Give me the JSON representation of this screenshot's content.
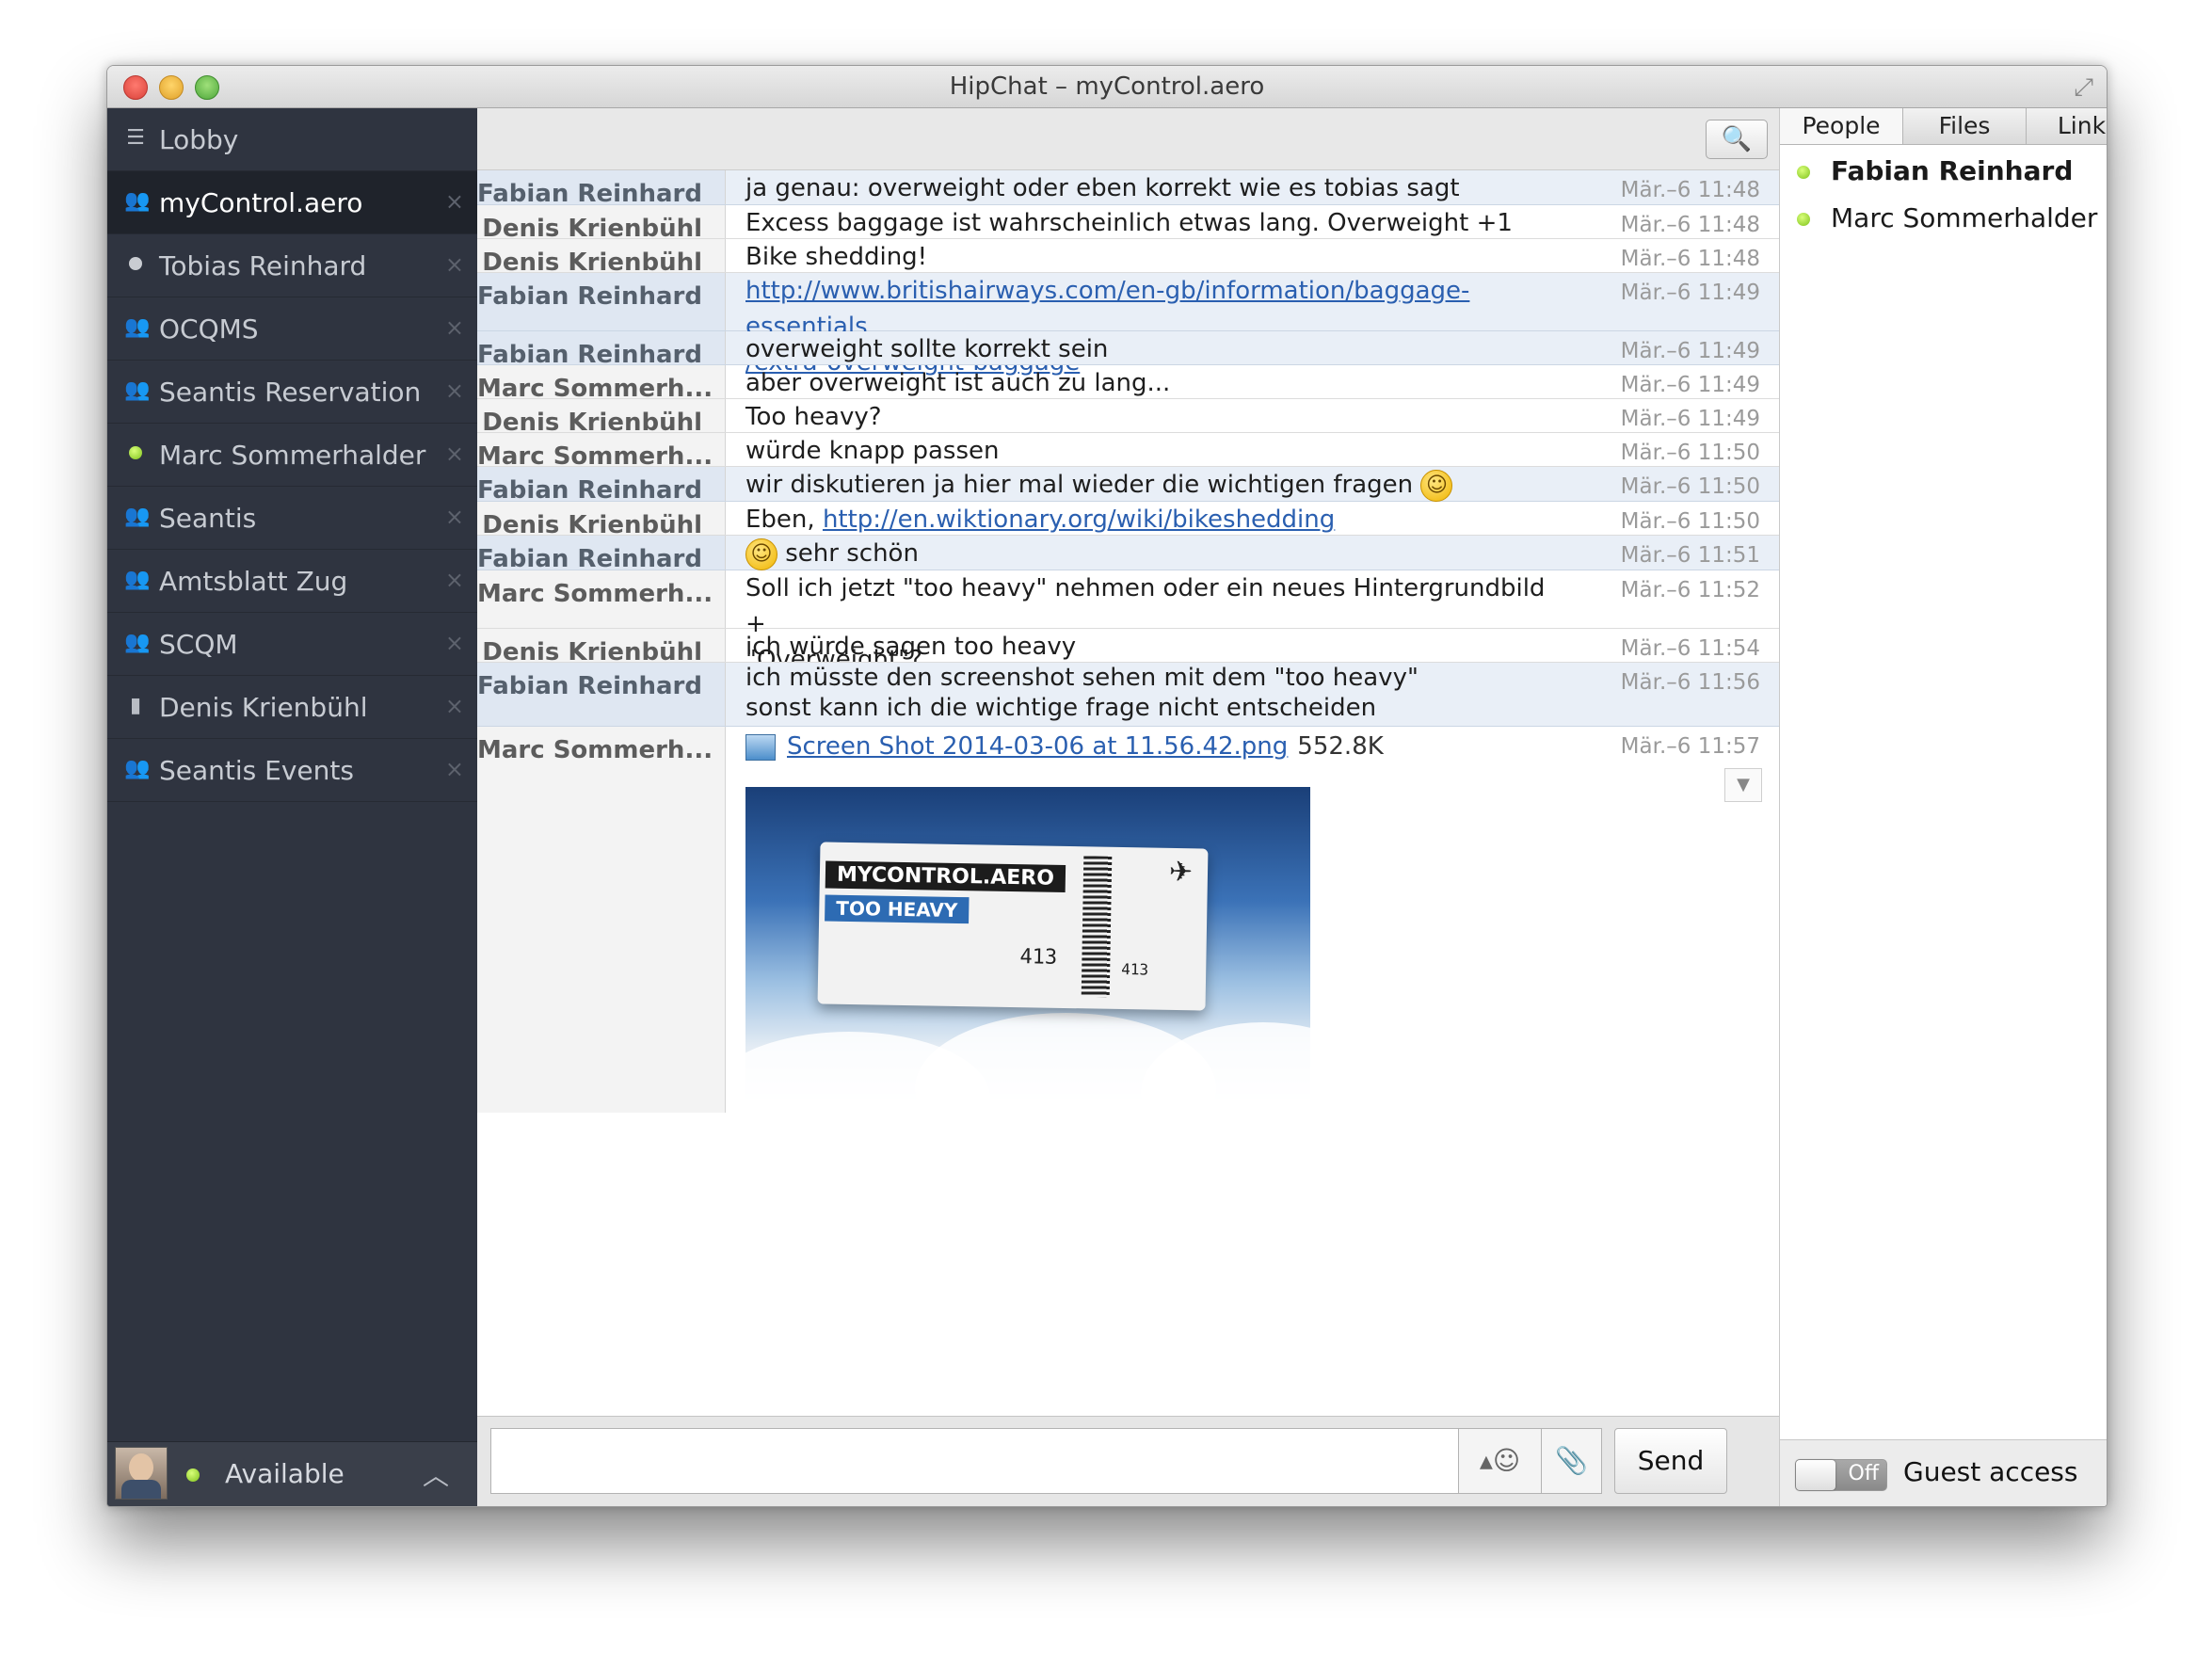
{
  "window": {
    "title": "HipChat – myControl.aero"
  },
  "sidebar": {
    "rooms": [
      {
        "label": "Lobby",
        "icon": "list-icon",
        "closable": false
      },
      {
        "label": "myControl.aero",
        "icon": "group-icon",
        "closable": true,
        "active": true
      },
      {
        "label": "Tobias Reinhard",
        "icon": "grey-status-dot",
        "closable": true
      },
      {
        "label": "OCQMS",
        "icon": "group-icon",
        "closable": true
      },
      {
        "label": "Seantis Reservation",
        "icon": "group-icon",
        "closable": true
      },
      {
        "label": "Marc Sommerhalder",
        "icon": "green-status-dot",
        "closable": true
      },
      {
        "label": "Seantis",
        "icon": "group-icon",
        "closable": true
      },
      {
        "label": "Amtsblatt Zug",
        "icon": "group-icon",
        "closable": true
      },
      {
        "label": "SCQM",
        "icon": "group-icon",
        "closable": true
      },
      {
        "label": "Denis Krienbühl",
        "icon": "mobile-icon",
        "closable": true
      },
      {
        "label": "Seantis Events",
        "icon": "group-icon",
        "closable": true
      }
    ],
    "close_glyph": "×",
    "status": {
      "label": "Available",
      "color": "#7fc21c"
    }
  },
  "chat": {
    "messages": [
      {
        "sender": "Fabian Reinhard",
        "text": "ja genau: overweight oder eben korrekt wie es tobias sagt",
        "time": "Mär.–6 11:48"
      },
      {
        "sender": "Denis Krienbühl",
        "text": "Excess baggage ist wahrscheinlich etwas lang. Overweight +1",
        "time": "Mär.–6 11:48"
      },
      {
        "sender": "Denis Krienbühl",
        "text": "Bike shedding!",
        "time": "Mär.–6 11:48"
      },
      {
        "sender": "Fabian Reinhard",
        "link_line1": "http://www.britishairways.com/en-gb/information/baggage-essentials",
        "link_line2": "/extra-overweight-baggage",
        "time": "Mär.–6 11:49"
      },
      {
        "sender": "Fabian Reinhard",
        "text": "overweight sollte korrekt sein",
        "time": "Mär.–6 11:49"
      },
      {
        "sender": "Marc Sommerh...",
        "text": "aber overweight ist auch zu lang...",
        "time": "Mär.–6 11:49"
      },
      {
        "sender": "Denis Krienbühl",
        "text": "Too heavy?",
        "time": "Mär.–6 11:49"
      },
      {
        "sender": "Marc Sommerh...",
        "text": "würde knapp passen",
        "time": "Mär.–6 11:50"
      },
      {
        "sender": "Fabian Reinhard",
        "text": "wir diskutieren ja hier mal wieder die wichtigen fragen",
        "time": "Mär.–6 11:50"
      },
      {
        "sender": "Denis Krienbühl",
        "text": "Eben, ",
        "link": "http://en.wiktionary.org/wiki/bikeshedding",
        "time": "Mär.–6 11:50"
      },
      {
        "sender": "Fabian Reinhard",
        "text": "sehr schön",
        "time": "Mär.–6 11:51"
      },
      {
        "sender": "Marc Sommerh...",
        "text_line1": "Soll ich jetzt \"too heavy\" nehmen oder ein neues Hintergrundbild +",
        "text_line2": "\"Overweight\"?",
        "time": "Mär.–6 11:52"
      },
      {
        "sender": "Denis Krienbühl",
        "text": "ich würde sagen too heavy",
        "time": "Mär.–6 11:54"
      },
      {
        "sender": "Fabian Reinhard",
        "text_line1": "ich müsste den screenshot sehen mit dem \"too heavy\"",
        "text_line2": "sonst kann ich die wichtige frage nicht entscheiden",
        "time": "Mär.–6 11:56"
      },
      {
        "sender": "Marc Sommerh...",
        "file_name": "Screen Shot 2014-03-06 at 11.56.42.png",
        "file_size": "552.8K",
        "time": "Mär.–6 11:57"
      }
    ],
    "preview": {
      "title": "MYCONTROL.AERO",
      "subtitle": "TOO HEAVY",
      "seat": "413",
      "seat_small": "413"
    },
    "compose": {
      "placeholder": "",
      "send_label": "Send"
    }
  },
  "right_panel": {
    "tabs": [
      "People",
      "Files",
      "Links"
    ],
    "people": [
      {
        "name": "Fabian Reinhard",
        "bold": true
      },
      {
        "name": "Marc Sommerhalder",
        "bold": false
      }
    ],
    "guest_access": {
      "toggle_label": "Off",
      "label": "Guest access"
    }
  },
  "icons": {
    "search": "search-icon",
    "emoji": "smiley-icon",
    "attach": "paperclip-icon"
  },
  "colors": {
    "sidebar_bg": "#2f3440",
    "highlight_row": "#e9eff7",
    "link": "#2a5fb0",
    "online": "#7fc21c"
  }
}
